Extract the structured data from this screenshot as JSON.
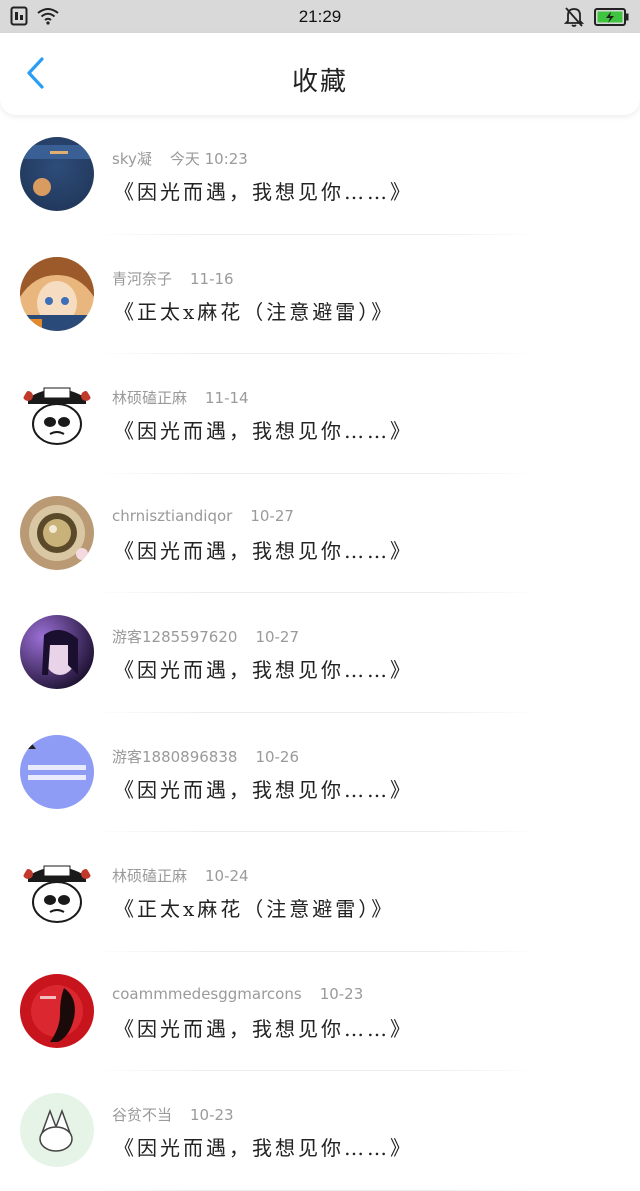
{
  "status_bar": {
    "time": "21:29",
    "battery_color": "#3ec43e"
  },
  "header": {
    "title": "收藏",
    "back_icon": "chevron-left-icon",
    "accent": "#2a9df4"
  },
  "items": [
    {
      "name": "sky凝",
      "date": "今天 10:23",
      "text": "《因光而遇，我想见你……》",
      "avatar_colors": [
        "#1f3557",
        "#2e4d7a"
      ]
    },
    {
      "name": "青河奈子",
      "date": "11-16",
      "text": "《正太x麻花（注意避雷）》",
      "avatar_colors": [
        "#b8743b",
        "#f2d2a8"
      ]
    },
    {
      "name": "林硕磕正麻",
      "date": "11-14",
      "text": "《因光而遇，我想见你……》",
      "avatar_colors": [
        "#ffffff",
        "#c0392b"
      ]
    },
    {
      "name": "chrnisztiandiqor",
      "date": "10-27",
      "text": "《因光而遇，我想见你……》",
      "avatar_colors": [
        "#8a6a4a",
        "#d9c7a3"
      ]
    },
    {
      "name": "游客1285597620",
      "date": "10-27",
      "text": "《因光而遇，我想见你……》",
      "avatar_colors": [
        "#2a1a4a",
        "#9b6fd6"
      ]
    },
    {
      "name": "游客1880896838",
      "date": "10-26",
      "text": "《因光而遇，我想见你……》",
      "avatar_colors": [
        "#7b8cf0",
        "#a9b4ff"
      ]
    },
    {
      "name": "林硕磕正麻",
      "date": "10-24",
      "text": "《正太x麻花（注意避雷）》",
      "avatar_colors": [
        "#ffffff",
        "#c0392b"
      ]
    },
    {
      "name": "coammmedesggmarcons",
      "date": "10-23",
      "text": "《因光而遇，我想见你……》",
      "avatar_colors": [
        "#c4121b",
        "#e8343c"
      ]
    },
    {
      "name": "谷贫不当",
      "date": "10-23",
      "text": "《因光而遇，我想见你……》",
      "avatar_colors": [
        "#d6ecd8",
        "#f2faf2"
      ]
    }
  ]
}
